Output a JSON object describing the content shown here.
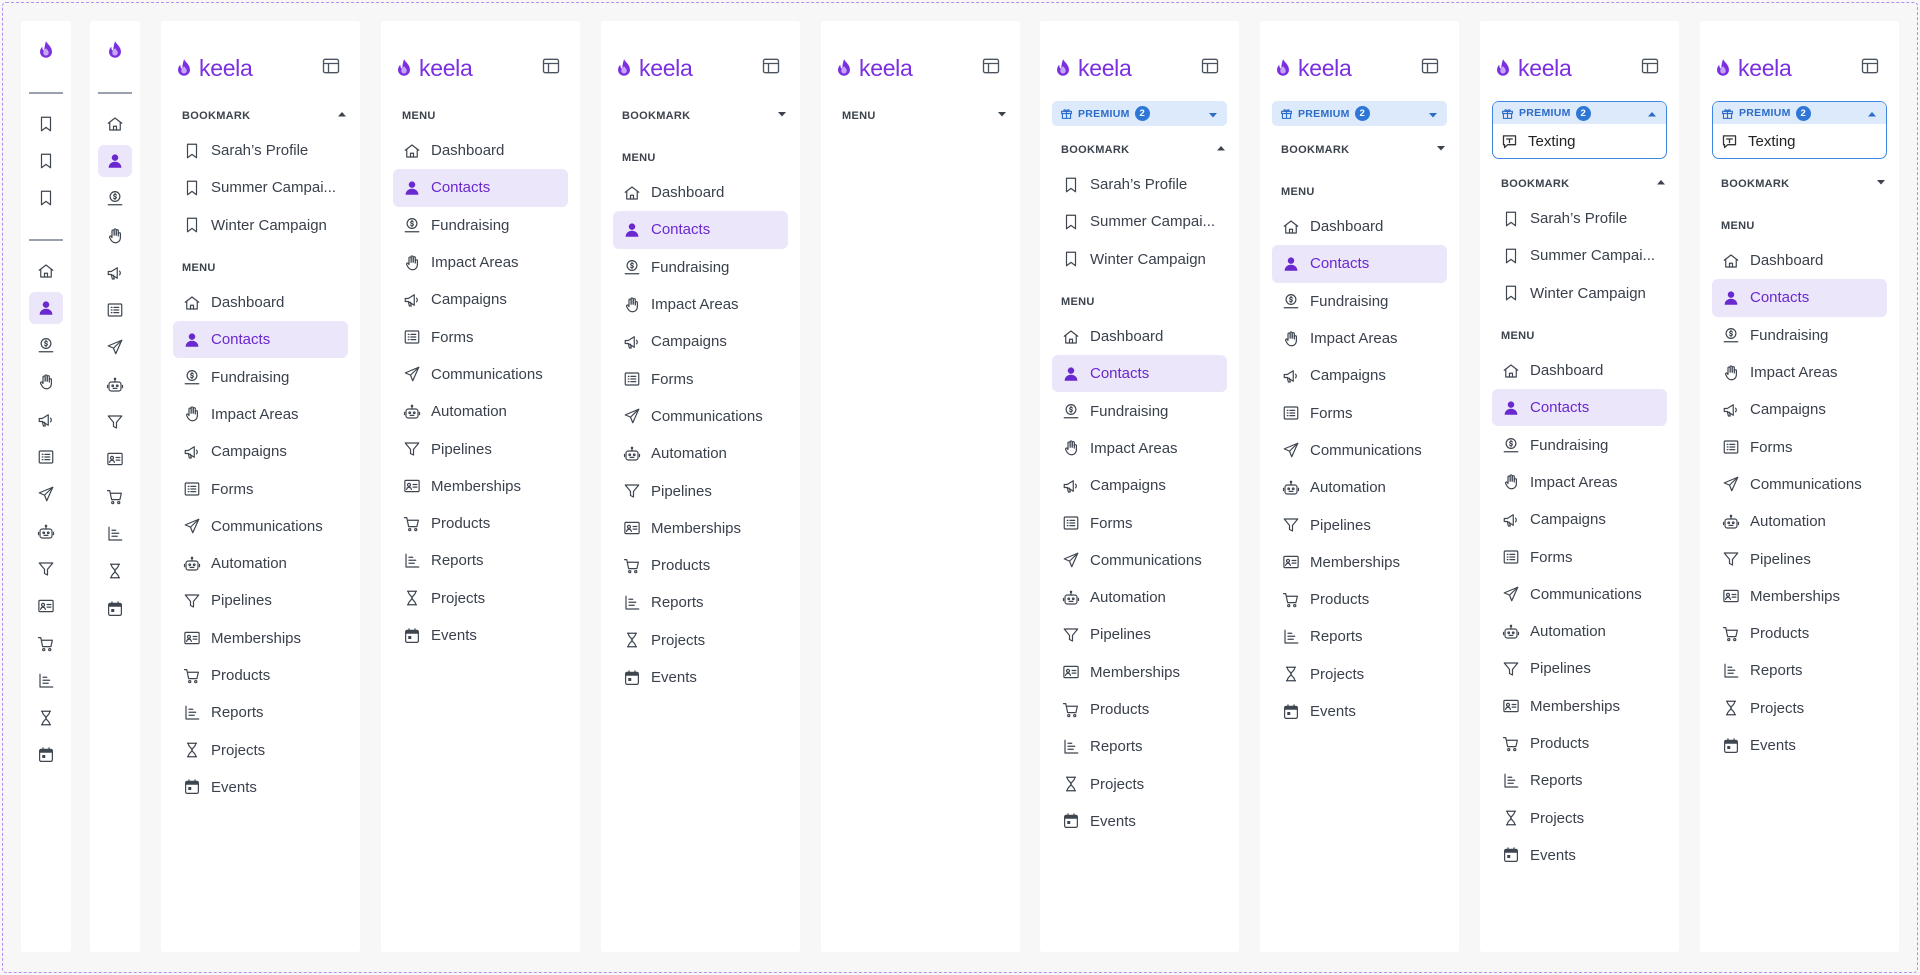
{
  "app": {
    "brand": "keela",
    "accent": "#7b2fe0",
    "active_bg": "#ece6fb",
    "premium_bg": "#ddeafb"
  },
  "labels": {
    "bookmark": "BOOKMARK",
    "menu": "MENU",
    "premium": "PREMIUM",
    "premium_count": "2",
    "texting": "Texting"
  },
  "bookmarks": [
    {
      "label": "Sarah’s Profile",
      "icon": "bookmark-icon"
    },
    {
      "label": "Summer Campai...",
      "icon": "bookmark-icon"
    },
    {
      "label": "Winter Campaign",
      "icon": "bookmark-icon"
    }
  ],
  "menu": [
    {
      "key": "dashboard",
      "label": "Dashboard",
      "icon": "home-icon"
    },
    {
      "key": "contacts",
      "label": "Contacts",
      "icon": "person-icon",
      "active": true
    },
    {
      "key": "fundraising",
      "label": "Fundraising",
      "icon": "dollar-hand-icon"
    },
    {
      "key": "impact-areas",
      "label": "Impact Areas",
      "icon": "hand-icon"
    },
    {
      "key": "campaigns",
      "label": "Campaigns",
      "icon": "megaphone-icon"
    },
    {
      "key": "forms",
      "label": "Forms",
      "icon": "form-icon"
    },
    {
      "key": "communications",
      "label": "Communications",
      "icon": "send-icon"
    },
    {
      "key": "automation",
      "label": "Automation",
      "icon": "robot-icon"
    },
    {
      "key": "pipelines",
      "label": "Pipelines",
      "icon": "funnel-icon"
    },
    {
      "key": "memberships",
      "label": "Memberships",
      "icon": "id-card-icon"
    },
    {
      "key": "products",
      "label": "Products",
      "icon": "cart-icon"
    },
    {
      "key": "reports",
      "label": "Reports",
      "icon": "chart-icon"
    },
    {
      "key": "projects",
      "label": "Projects",
      "icon": "hourglass-icon"
    },
    {
      "key": "events",
      "label": "Events",
      "icon": "calendar-icon"
    }
  ]
}
